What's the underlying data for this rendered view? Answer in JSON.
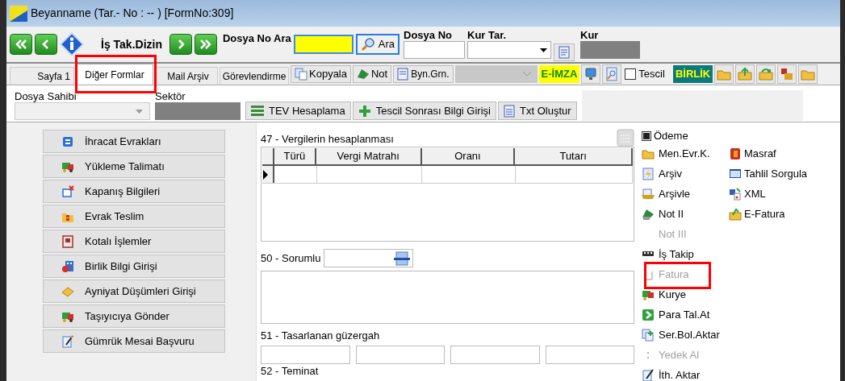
{
  "window": {
    "title": "Beyanname (Tar.- No :  --  )  [FormNo:309]"
  },
  "toolbar": {
    "label": "İş Tak.Dizin",
    "search_label": "Dosya No Ara",
    "search_button": "Ara",
    "dosya_no": "Dosya No",
    "kur_tar": "Kur Tar.",
    "kur": "Kur"
  },
  "tabs": [
    {
      "label": "Sayfa 1",
      "selected": false
    },
    {
      "label": "Diğer Formlar",
      "selected": true
    },
    {
      "label": "Mail Arşiv",
      "selected": false
    },
    {
      "label": "Görevlendirme",
      "selected": false
    }
  ],
  "tab_toolbar": {
    "copy": "Kopyala",
    "note": "Not",
    "byn": "Byn.Grn.",
    "e_imza": "E-İMZA",
    "tescil": {
      "label": "Tescil",
      "checked": false
    },
    "birlik": "BİRLİK"
  },
  "form": {
    "dosya_sahibi": "Dosya Sahibi",
    "sektor": "Sektör",
    "actions": [
      "TEV Hesaplama",
      "Tescil Sonrası Bilgi Girişi",
      "Txt Oluştur"
    ]
  },
  "left_buttons": [
    "İhracat Evrakları",
    "Yükleme Talimatı",
    "Kapanış Bilgileri",
    "Evrak Teslim",
    "Kotalı İşlemler",
    "Birlik Bilgi Girişi",
    "Ayniyat Düşümleri Girişi",
    "Taşıyıcıya Gönder",
    "Gümrük Mesai Başvuru"
  ],
  "taxes": {
    "title": "47 - Vergilerin hesaplanması",
    "columns": [
      "Türü",
      "Vergi Matrahı",
      "Oranı",
      "Tutarı"
    ]
  },
  "sorumlu": "50 - Sorumlu",
  "guzergah": "51 - Tasarlanan güzergah",
  "teminat": "52 - Teminat",
  "side_menu": {
    "odeme": {
      "label": "Ödeme",
      "checked": true
    },
    "column_1": [
      {
        "label": "Men.Evr.K.",
        "disabled": false
      },
      {
        "label": "Arşiv",
        "disabled": false
      },
      {
        "label": "Arşivle",
        "disabled": false
      },
      {
        "label": "Not II",
        "disabled": false
      },
      {
        "label": "Not III",
        "disabled": true
      },
      {
        "label": "İş Takip",
        "disabled": false
      },
      {
        "label": "Fatura",
        "disabled": true
      },
      {
        "label": "Kurye",
        "disabled": false
      },
      {
        "label": "Para Tal.At",
        "disabled": false
      },
      {
        "label": "Ser.Bol.Aktar",
        "disabled": false
      },
      {
        "label": "Yedek Al",
        "disabled": true
      },
      {
        "label": "İth. Aktar",
        "disabled": false
      }
    ],
    "column_2": [
      {
        "label": "Masraf",
        "disabled": false
      },
      {
        "label": "Tahlil Sorgula",
        "disabled": false
      },
      {
        "label": "XML",
        "disabled": false
      },
      {
        "label": "E-Fatura",
        "disabled": false
      }
    ]
  }
}
